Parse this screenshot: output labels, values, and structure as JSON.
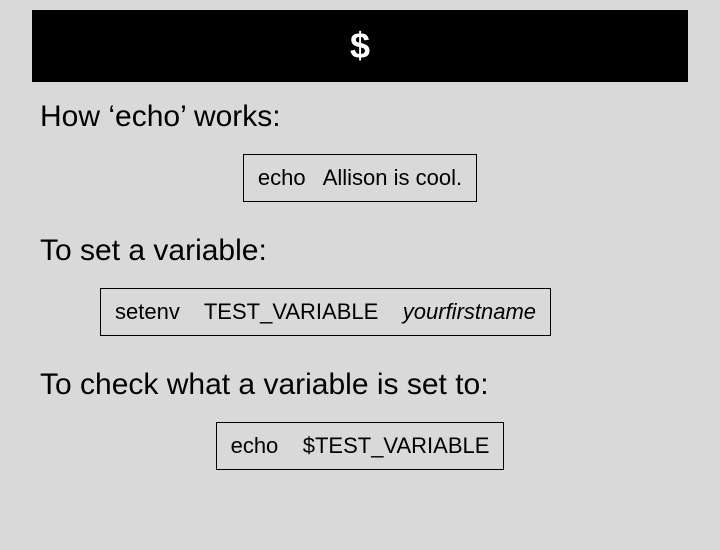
{
  "title": "$",
  "sections": {
    "echo_works": {
      "heading": "How ‘echo’ works:",
      "code": "echo   Allison is cool."
    },
    "set_var": {
      "heading": "To set a variable:",
      "code_cmd": "setenv    TEST_VARIABLE    ",
      "code_arg": "yourfirstname"
    },
    "check_var": {
      "heading": "To check what a variable is set to:",
      "code": "echo    $TEST_VARIABLE"
    }
  }
}
